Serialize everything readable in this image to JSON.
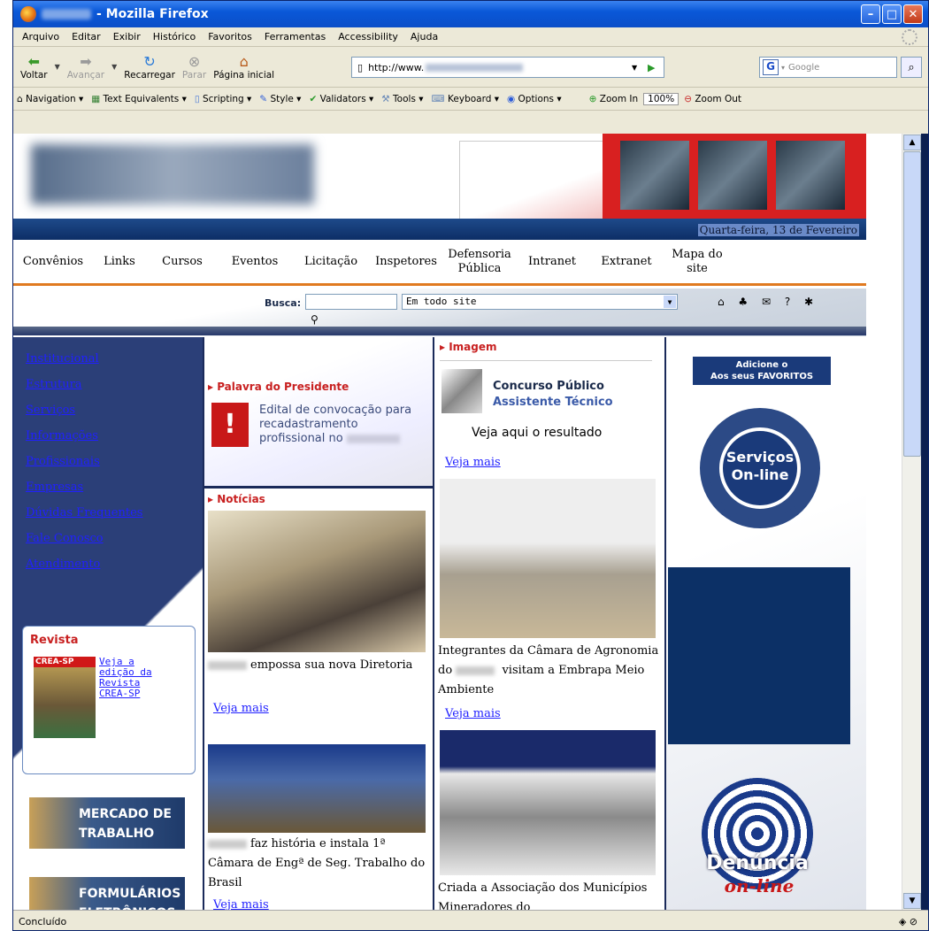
{
  "window": {
    "title": "- Mozilla Firefox"
  },
  "menu": [
    "Arquivo",
    "Editar",
    "Exibir",
    "Histórico",
    "Favoritos",
    "Ferramentas",
    "Accessibility",
    "Ajuda"
  ],
  "nav": {
    "back": "Voltar",
    "forward": "Avançar",
    "reload": "Recarregar",
    "stop": "Parar",
    "home": "Página inicial",
    "url": "http://www.",
    "search_placeholder": "Google"
  },
  "toolbar": [
    "Navigation ▾",
    "Text Equivalents ▾",
    "Scripting ▾",
    "Style ▾",
    "Validators ▾",
    "Tools ▾",
    "Keyboard ▾",
    "Options ▾"
  ],
  "zoom": {
    "zoom_in": "Zoom In",
    "level": "100%",
    "zoom_out": "Zoom Out"
  },
  "status": "Concluído",
  "site": {
    "date": "Quarta-feira, 13 de Fevereiro",
    "menu": [
      "Convênios",
      "Links",
      "Cursos",
      "Eventos",
      "Licitação",
      "Inspetores",
      "Defensoria Pública",
      "Intranet",
      "Extranet",
      "Mapa do site"
    ],
    "search_label": "Busca:",
    "search_scope": "Em todo site",
    "left_links": [
      "Institucional",
      "Estrutura",
      "Serviços",
      "Informações",
      "Profissionais",
      "Empresas",
      "Dúvidas Frequentes",
      "Fale Conosco",
      "Atendimento"
    ],
    "revista": {
      "title": "Revista",
      "cover": "CREA-SP",
      "link": "Veja a edição da Revista CREA-SP"
    },
    "banners": [
      "MERCADO DE TRABALHO",
      "FORMULÁRIOS ELETRÔNICOS"
    ],
    "pres": {
      "title": "Palavra do Presidente",
      "text": "Edital de convocação para recadastramento profissional no"
    },
    "noticias": {
      "title": "Notícias",
      "item1": "empossa sua nova Diretoria",
      "item2": "faz história e instala 1ª Câmara de Engª de Seg. Trabalho do Brasil",
      "more": "Veja mais"
    },
    "imagem": {
      "title": "Imagem",
      "concurso1": "Concurso Público",
      "concurso2": "Assistente Técnico",
      "result": "Veja aqui o resultado",
      "more": "Veja mais",
      "cap1a": "Integrantes da Câmara de Agronomia do",
      "cap1b": "visitam a Embrapa Meio Ambiente",
      "cap2": "Criada a Associação dos Municípios Mineradores do"
    },
    "fav": {
      "l1": "Adicione o",
      "l2": "Aos seus FAVORITOS"
    },
    "servicos": "Serviços On-line",
    "denuncia": {
      "t": "Denúncia",
      "s": "on-line"
    }
  }
}
